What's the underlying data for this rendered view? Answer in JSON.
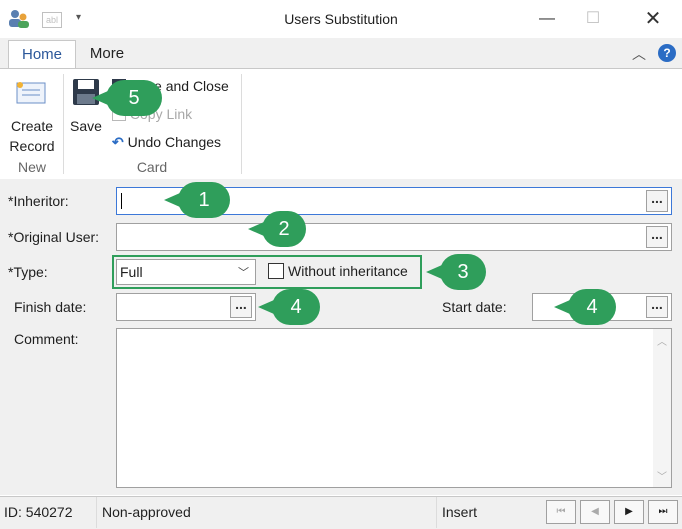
{
  "window": {
    "title": "Users Substitution"
  },
  "tabs": [
    {
      "label": "Home"
    },
    {
      "label": "More"
    }
  ],
  "ribbon": {
    "create_record": {
      "line1": "Create",
      "line2": "Record",
      "group": "New"
    },
    "save": {
      "label": "Save"
    },
    "save_and_close": "Save and Close",
    "copy_link": "Copy Link",
    "undo_changes": "Undo Changes",
    "card_group": "Card"
  },
  "form": {
    "inheritor_label": "*Inheritor:",
    "inheritor_value": "",
    "original_user_label": "*Original User:",
    "original_user_value": "",
    "type_label": "*Type:",
    "type_value": "Full",
    "without_inheritance_label": "Without inheritance",
    "finish_date_label": "Finish date:",
    "start_date_label": "Start date:",
    "comment_label": "Comment:"
  },
  "callouts": [
    "1",
    "2",
    "3",
    "4",
    "4",
    "5"
  ],
  "status": {
    "id": "ID: 540272",
    "state": "Non-approved",
    "mode": "Insert"
  },
  "colors": {
    "callout": "#2f9e5b",
    "highlight_border": "#2f9e5b",
    "accent": "#2b579a"
  }
}
